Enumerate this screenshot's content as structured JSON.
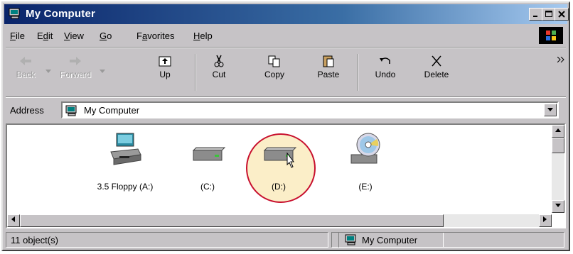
{
  "window": {
    "title": "My Computer"
  },
  "menu": [
    "File",
    "Edit",
    "View",
    "Go",
    "Favorites",
    "Help"
  ],
  "menu_underline": [
    "F",
    "d",
    "V",
    "G",
    "a",
    "H"
  ],
  "toolbar": [
    {
      "label": "Back",
      "icon": "back-arrow-icon",
      "enabled": false
    },
    {
      "label": "Forward",
      "icon": "forward-arrow-icon",
      "enabled": false
    },
    {
      "label": "Up",
      "icon": "up-folder-icon",
      "enabled": true
    },
    {
      "label": "Cut",
      "icon": "scissors-icon",
      "enabled": true
    },
    {
      "label": "Copy",
      "icon": "copy-icon",
      "enabled": true
    },
    {
      "label": "Paste",
      "icon": "paste-icon",
      "enabled": true
    },
    {
      "label": "Undo",
      "icon": "undo-icon",
      "enabled": true
    },
    {
      "label": "Delete",
      "icon": "delete-x-icon",
      "enabled": true
    }
  ],
  "address": {
    "label": "Address",
    "value": "My Computer"
  },
  "drives": [
    {
      "label": "3.5 Floppy (A:)",
      "icon": "floppy-drive-icon"
    },
    {
      "label": "(C:)",
      "icon": "hard-drive-icon"
    },
    {
      "label": "(D:)",
      "icon": "hard-drive-icon",
      "highlighted": true
    },
    {
      "label": "(E:)",
      "icon": "cd-drive-icon"
    }
  ],
  "status": {
    "count": "11 object(s)",
    "location": "My Computer"
  },
  "colors": {
    "highlight_ring": "#c8102e",
    "highlight_fill": "#fbeec8",
    "titlebar_start": "#0a246a"
  }
}
